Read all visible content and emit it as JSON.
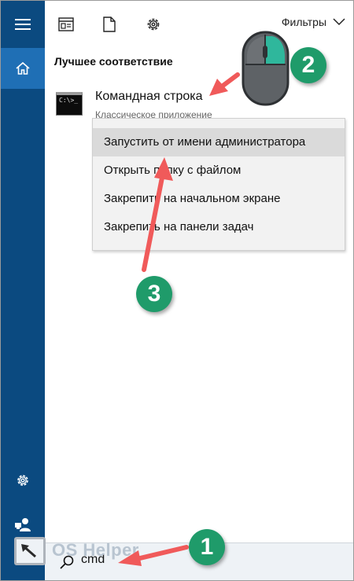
{
  "toolbar": {
    "filters_label": "Фильтры"
  },
  "best_match": {
    "heading": "Лучшее соответствие",
    "title": "Командная строка",
    "subtitle": "Классическое приложение",
    "icon_text": "C:\\>_"
  },
  "context_menu": [
    {
      "label": "Запустить от имени администратора",
      "highlighted": true
    },
    {
      "label": "Открыть папку с файлом",
      "highlighted": false
    },
    {
      "label": "Закрепить на начальном экране",
      "highlighted": false
    },
    {
      "label": "Закрепить на панели задач",
      "highlighted": false
    }
  ],
  "search": {
    "value": "cmd"
  },
  "watermark": {
    "text": "OS Helper"
  },
  "annotations": {
    "badges": [
      "1",
      "2",
      "3"
    ],
    "badge_color": "#1f9b6a",
    "arrow_color": "#f05a5a"
  },
  "colors": {
    "sidebar": "#0b4a80",
    "sidebar_active": "#1f6fb5",
    "menu_highlight": "#dadada"
  }
}
